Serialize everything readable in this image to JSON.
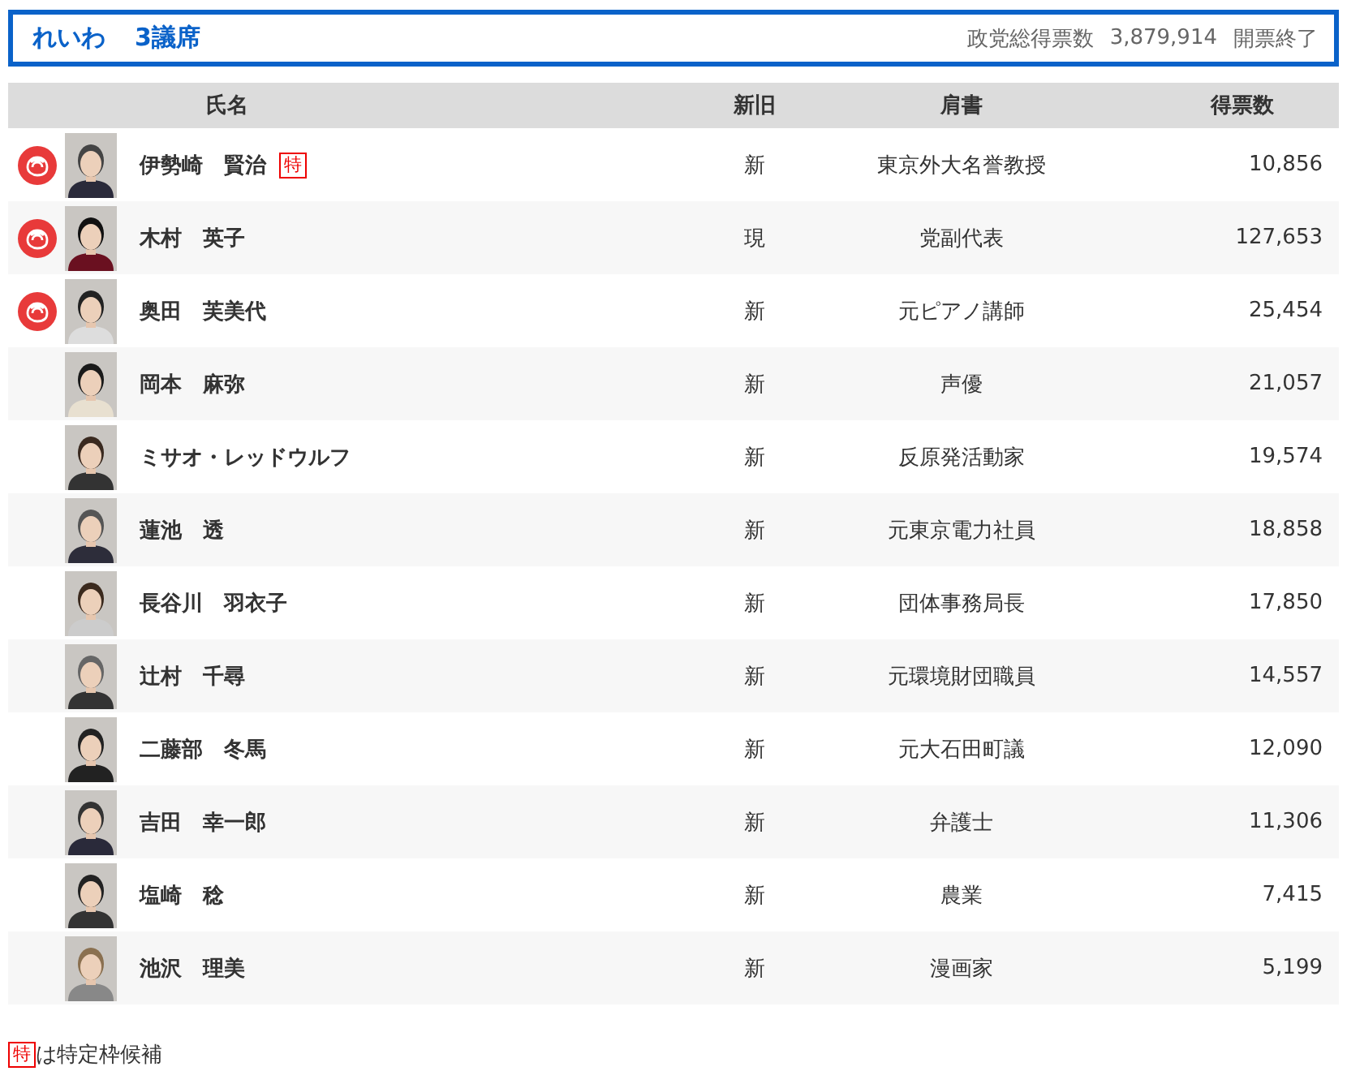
{
  "header": {
    "party": "れいわ",
    "seats": "3議席",
    "total_label": "政党総得票数",
    "total": "3,879,914",
    "status": "開票終了"
  },
  "columns": [
    "氏名",
    "新旧",
    "肩書",
    "得票数"
  ],
  "rows": [
    {
      "elected": true,
      "name": "伊勢崎　賢治",
      "badge": "特",
      "status": "新",
      "title": "東京外大名誉教授",
      "votes": "10,856"
    },
    {
      "elected": true,
      "name": "木村　英子",
      "status": "現",
      "title": "党副代表",
      "votes": "127,653"
    },
    {
      "elected": true,
      "name": "奥田　芙美代",
      "status": "新",
      "title": "元ピアノ講師",
      "votes": "25,454"
    },
    {
      "elected": false,
      "name": "岡本　麻弥",
      "status": "新",
      "title": "声優",
      "votes": "21,057"
    },
    {
      "elected": false,
      "name": "ミサオ・レッドウルフ",
      "status": "新",
      "title": "反原発活動家",
      "votes": "19,574"
    },
    {
      "elected": false,
      "name": "蓮池　透",
      "status": "新",
      "title": "元東京電力社員",
      "votes": "18,858"
    },
    {
      "elected": false,
      "name": "長谷川　羽衣子",
      "status": "新",
      "title": "団体事務局長",
      "votes": "17,850"
    },
    {
      "elected": false,
      "name": "辻村　千尋",
      "status": "新",
      "title": "元環境財団職員",
      "votes": "14,557"
    },
    {
      "elected": false,
      "name": "二藤部　冬馬",
      "status": "新",
      "title": "元大石田町議",
      "votes": "12,090"
    },
    {
      "elected": false,
      "name": "吉田　幸一郎",
      "status": "新",
      "title": "弁護士",
      "votes": "11,306"
    },
    {
      "elected": false,
      "name": "塩崎　稔",
      "status": "新",
      "title": "農業",
      "votes": "7,415"
    },
    {
      "elected": false,
      "name": "池沢　理美",
      "status": "新",
      "title": "漫画家",
      "votes": "5,199"
    }
  ],
  "legend": {
    "badge": "特",
    "text": "は特定枠候補"
  }
}
